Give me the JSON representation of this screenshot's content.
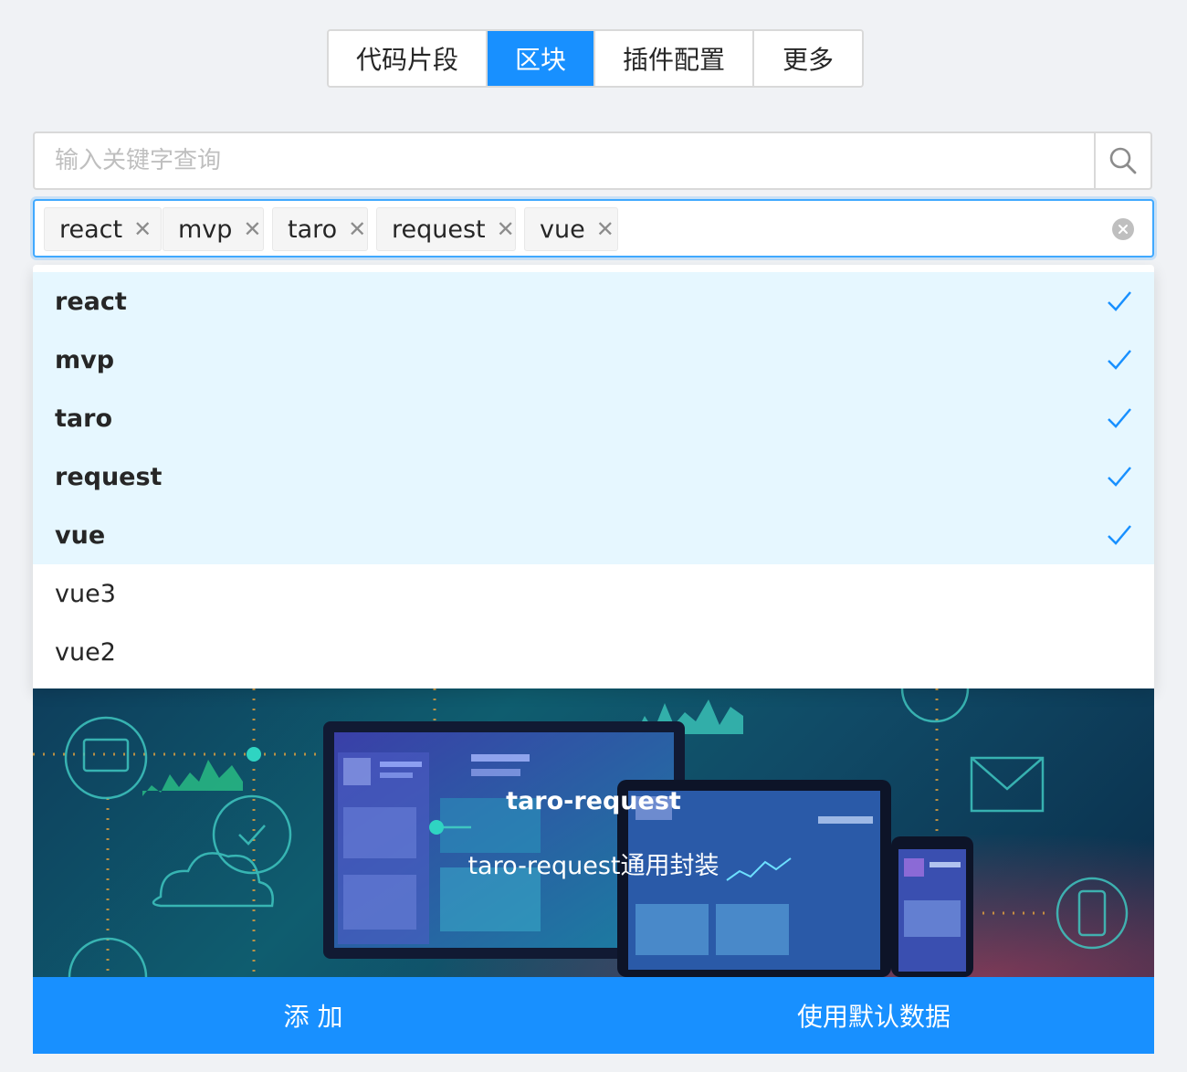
{
  "tabs": [
    {
      "label": "代码片段",
      "active": false
    },
    {
      "label": "区块",
      "active": true
    },
    {
      "label": "插件配置",
      "active": false
    },
    {
      "label": "更多",
      "active": false
    }
  ],
  "search": {
    "placeholder": "输入关键字查询",
    "icon": "search-icon"
  },
  "selected_tags": [
    "react",
    "mvp",
    "taro",
    "request",
    "vue"
  ],
  "dropdown": {
    "options": [
      {
        "label": "react",
        "selected": true
      },
      {
        "label": "mvp",
        "selected": true
      },
      {
        "label": "taro",
        "selected": true
      },
      {
        "label": "request",
        "selected": true
      },
      {
        "label": "vue",
        "selected": true
      },
      {
        "label": "vue3",
        "selected": false
      },
      {
        "label": "vue2",
        "selected": false
      }
    ]
  },
  "card": {
    "title": "taro-request",
    "description": "taro-request通用封装"
  },
  "footer": {
    "add_label": "添 加",
    "default_label": "使用默认数据"
  },
  "colors": {
    "primary": "#1890ff",
    "selected_bg": "#e6f7ff",
    "background": "#f0f2f5"
  }
}
